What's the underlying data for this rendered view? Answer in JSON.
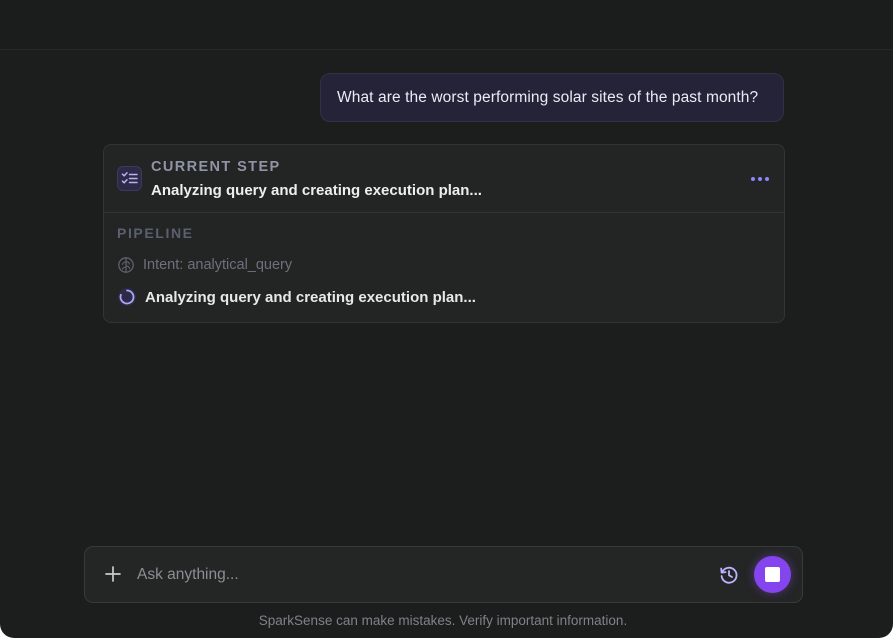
{
  "chat": {
    "user_message": "What are the worst performing solar sites of the past month?"
  },
  "current_step": {
    "label": "CURRENT STEP",
    "text": "Analyzing query and creating execution plan...",
    "icon": "checklist-icon",
    "more_icon": "more-horizontal-icon"
  },
  "pipeline": {
    "label": "PIPELINE",
    "items": [
      {
        "text": "Intent: analytical_query",
        "status": "done",
        "icon": "brain-icon"
      },
      {
        "text": "Analyzing query and creating execution plan...",
        "status": "in-progress",
        "icon": "spinner-icon"
      }
    ]
  },
  "composer": {
    "placeholder": "Ask anything...",
    "value": "",
    "add_icon": "plus-icon",
    "history_icon": "history-icon",
    "stop_icon": "stop-icon"
  },
  "footer": {
    "disclaimer": "SparkSense can make mistakes. Verify important information."
  },
  "colors": {
    "accent": "#8445ee",
    "background": "#1c1d1d",
    "user_bubble": "#252338"
  }
}
